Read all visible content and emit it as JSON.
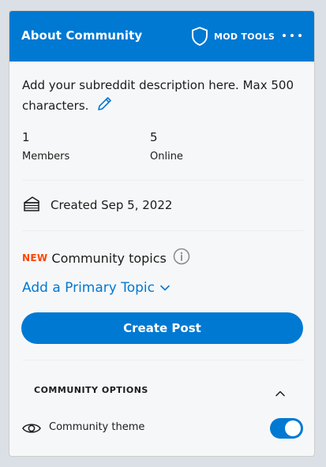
{
  "header": {
    "title": "About Community",
    "mod_tools_label": "MOD TOOLS",
    "color": "#0079d3"
  },
  "description": {
    "text": "Add your subreddit description here. Max 500 characters."
  },
  "stats": {
    "members_count": "1",
    "members_label": "Members",
    "online_count": "5",
    "online_label": "Online"
  },
  "created": {
    "text": "Created Sep 5, 2022"
  },
  "topics": {
    "new_badge": "NEW",
    "title": "Community topics",
    "add_primary_label": "Add a Primary Topic"
  },
  "create_post": {
    "label": "Create Post"
  },
  "community_options": {
    "title": "COMMUNITY OPTIONS",
    "theme_label": "Community theme",
    "theme_enabled": true
  },
  "icons": {
    "shield": "shield-icon",
    "more": "more-options-icon",
    "pencil": "pencil-icon",
    "cake": "cake-icon",
    "info": "info-icon",
    "chevron_down": "chevron-down-icon",
    "chevron_up": "chevron-up-icon",
    "eye": "eye-icon"
  },
  "colors": {
    "accent": "#0079d3",
    "new_badge": "#ff4500",
    "card_background": "#f6f7f8",
    "page_background": "#dae0e6"
  }
}
